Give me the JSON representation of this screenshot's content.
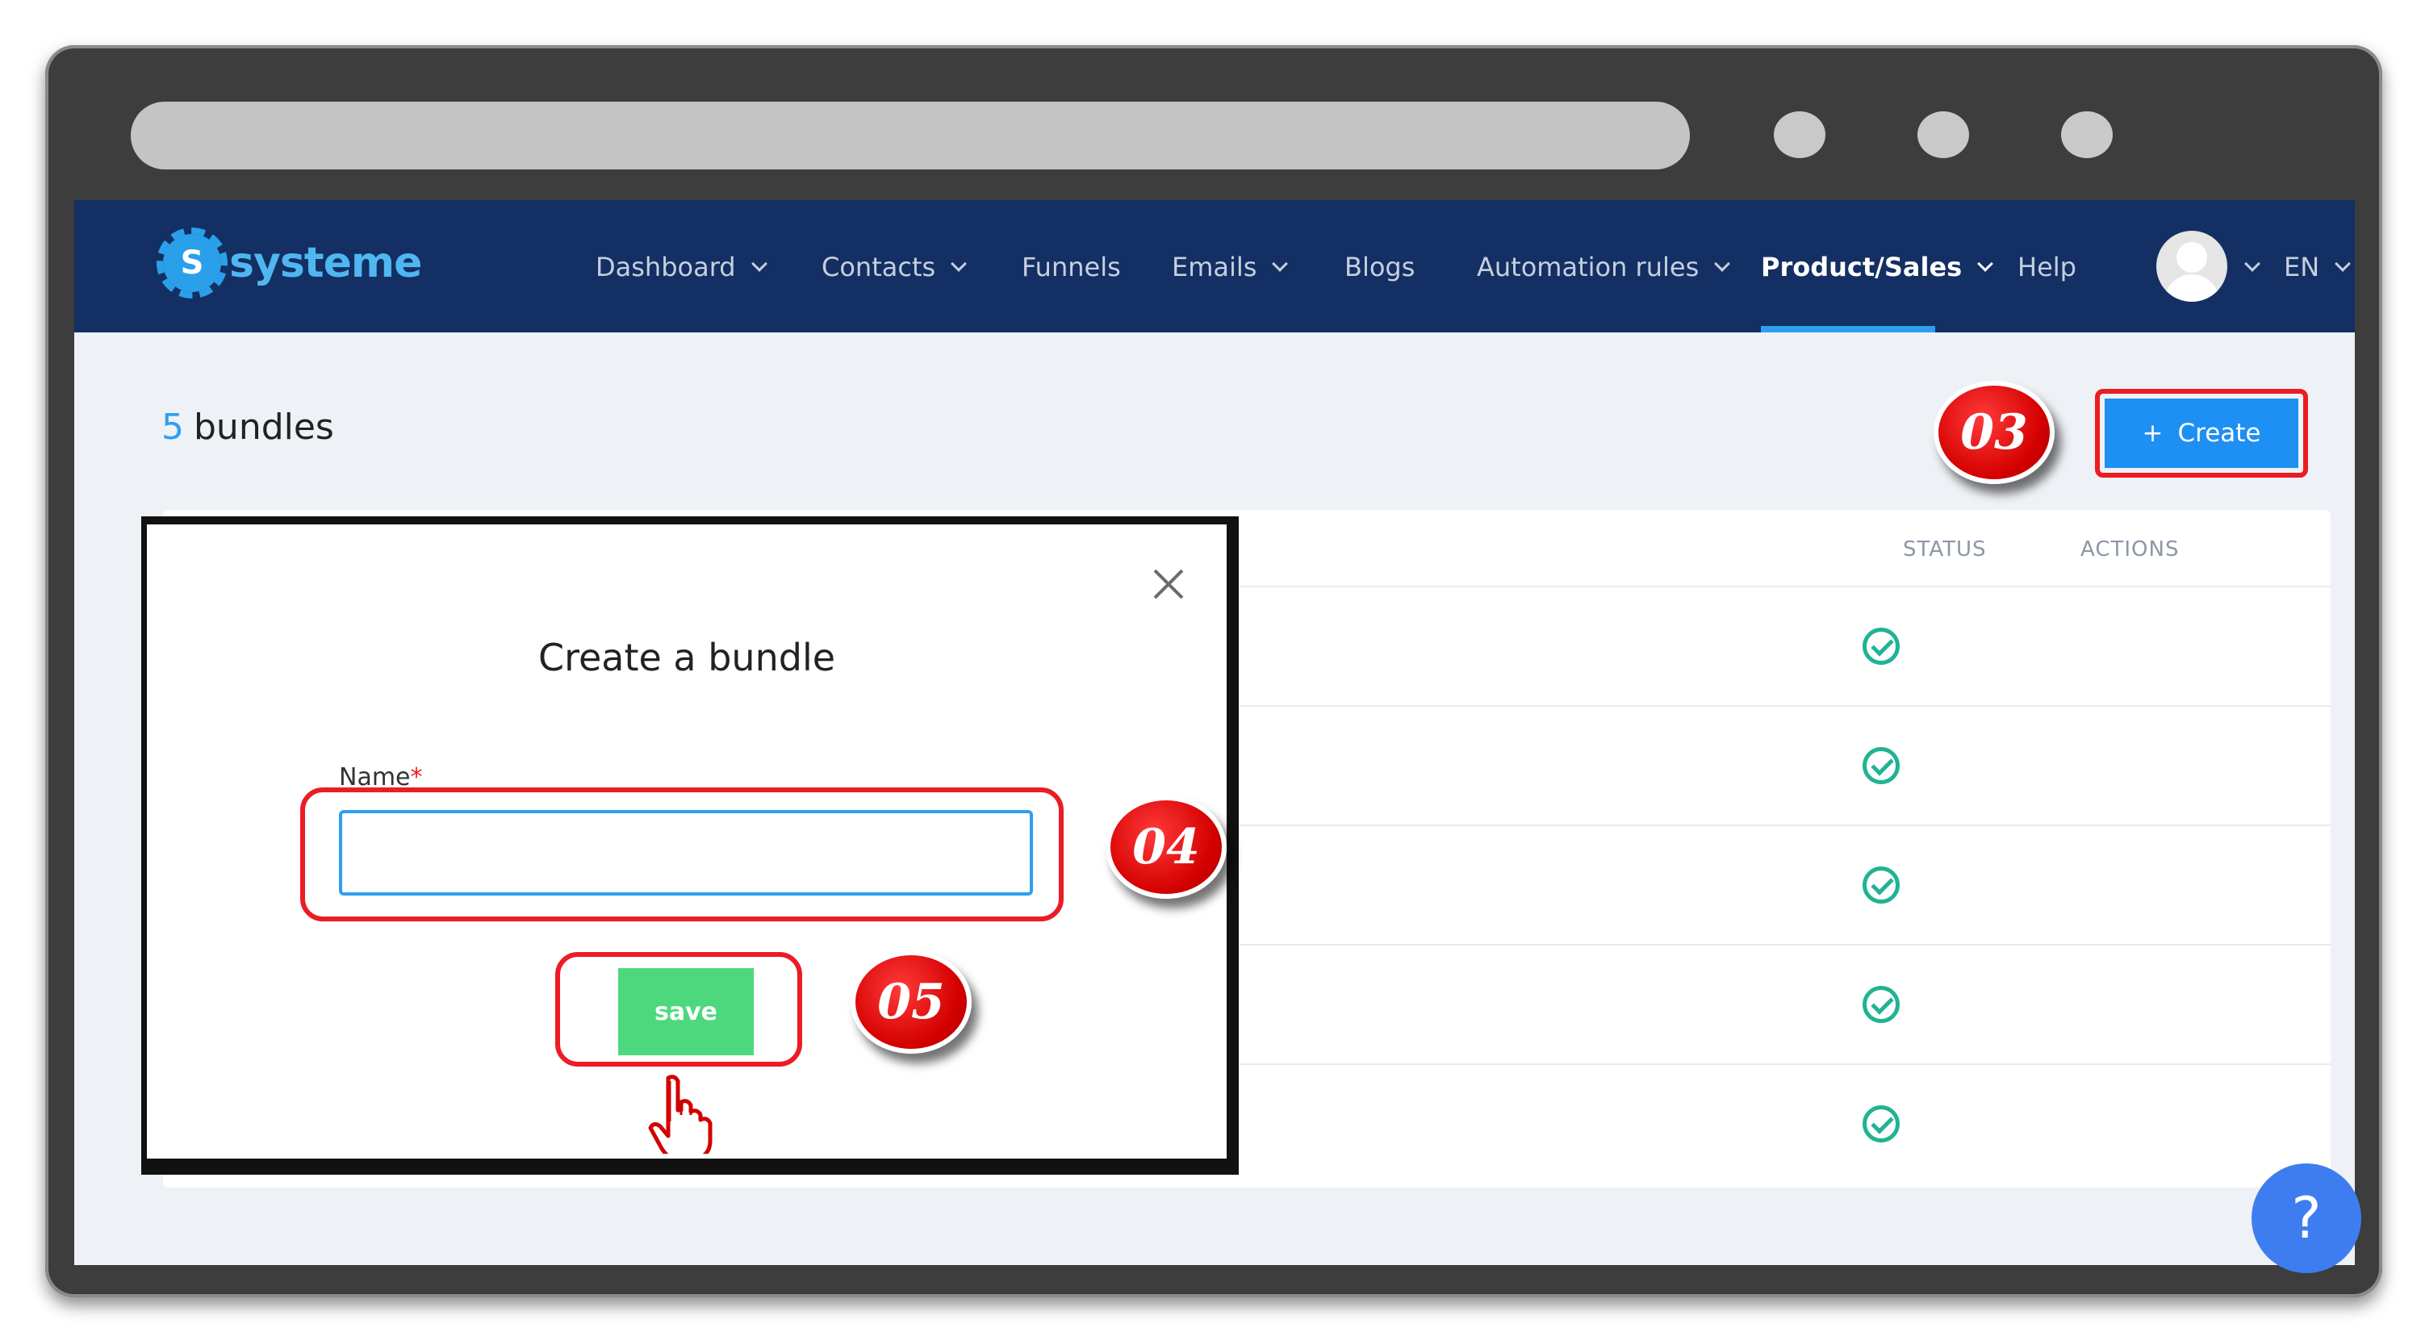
{
  "brand": {
    "name": "systeme",
    "mark": "S"
  },
  "nav": {
    "items": [
      {
        "label": "Dashboard",
        "dropdown": true
      },
      {
        "label": "Contacts",
        "dropdown": true
      },
      {
        "label": "Funnels",
        "dropdown": false
      },
      {
        "label": "Emails",
        "dropdown": true
      },
      {
        "label": "Blogs",
        "dropdown": false
      },
      {
        "label": "Automation rules",
        "dropdown": true
      },
      {
        "label": "Product/Sales",
        "dropdown": true,
        "active": true
      },
      {
        "label": "Help",
        "dropdown": false
      }
    ],
    "language": "EN"
  },
  "page": {
    "count": "5",
    "label": "bundles",
    "create_label": "Create",
    "create_icon": "+"
  },
  "table": {
    "headers": {
      "status": "STATUS",
      "actions": "ACTIONS"
    },
    "rows": [
      {
        "status": "active"
      },
      {
        "status": "active"
      },
      {
        "status": "active"
      },
      {
        "status": "active"
      },
      {
        "status": "active"
      }
    ]
  },
  "modal": {
    "title": "Create a bundle",
    "name_label": "Name",
    "required_mark": "*",
    "name_value": "",
    "save_label": "save"
  },
  "annotations": {
    "step_create": "03",
    "step_name": "04",
    "step_save": "05"
  },
  "help": {
    "label": "?"
  },
  "colors": {
    "navbar": "#132f63",
    "accent": "#1e8ff3",
    "save": "#4dd87e",
    "status": "#20b394",
    "annotation": "#ec1c24"
  }
}
